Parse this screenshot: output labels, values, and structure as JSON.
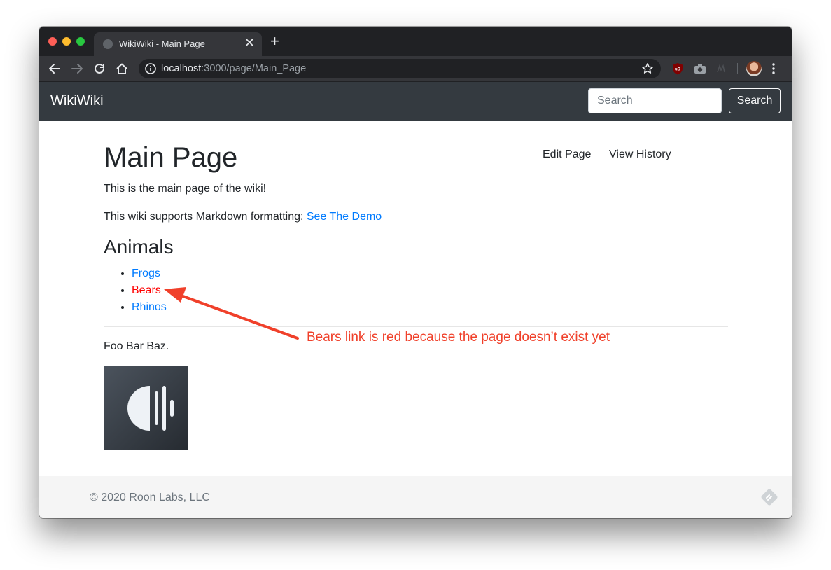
{
  "browser": {
    "tab_title": "WikiWiki - Main Page",
    "tab_close": "✕",
    "new_tab": "+",
    "url_host": "localhost",
    "url_path": ":3000/page/Main_Page"
  },
  "site": {
    "brand": "WikiWiki",
    "search_placeholder": "Search",
    "search_button": "Search"
  },
  "page": {
    "title": "Main Page",
    "actions": [
      "Edit Page",
      "View History"
    ],
    "intro": "This is the main page of the wiki!",
    "markdown_text": "This wiki supports Markdown formatting: ",
    "markdown_link": "See The Demo",
    "section_heading": "Animals",
    "animals": [
      {
        "label": "Frogs",
        "exists": true
      },
      {
        "label": "Bears",
        "exists": false
      },
      {
        "label": "Rhinos",
        "exists": true
      }
    ],
    "after_rule_text": "Foo Bar Baz."
  },
  "footer": {
    "copyright": "© 2020 Roon Labs, LLC"
  },
  "annotation": {
    "text": "Bears link is red because the page doesn’t exist yet",
    "color": "#f0402a"
  },
  "colors": {
    "link": "#007bff",
    "missing_link": "#ff0000",
    "navbar": "#343a40"
  }
}
